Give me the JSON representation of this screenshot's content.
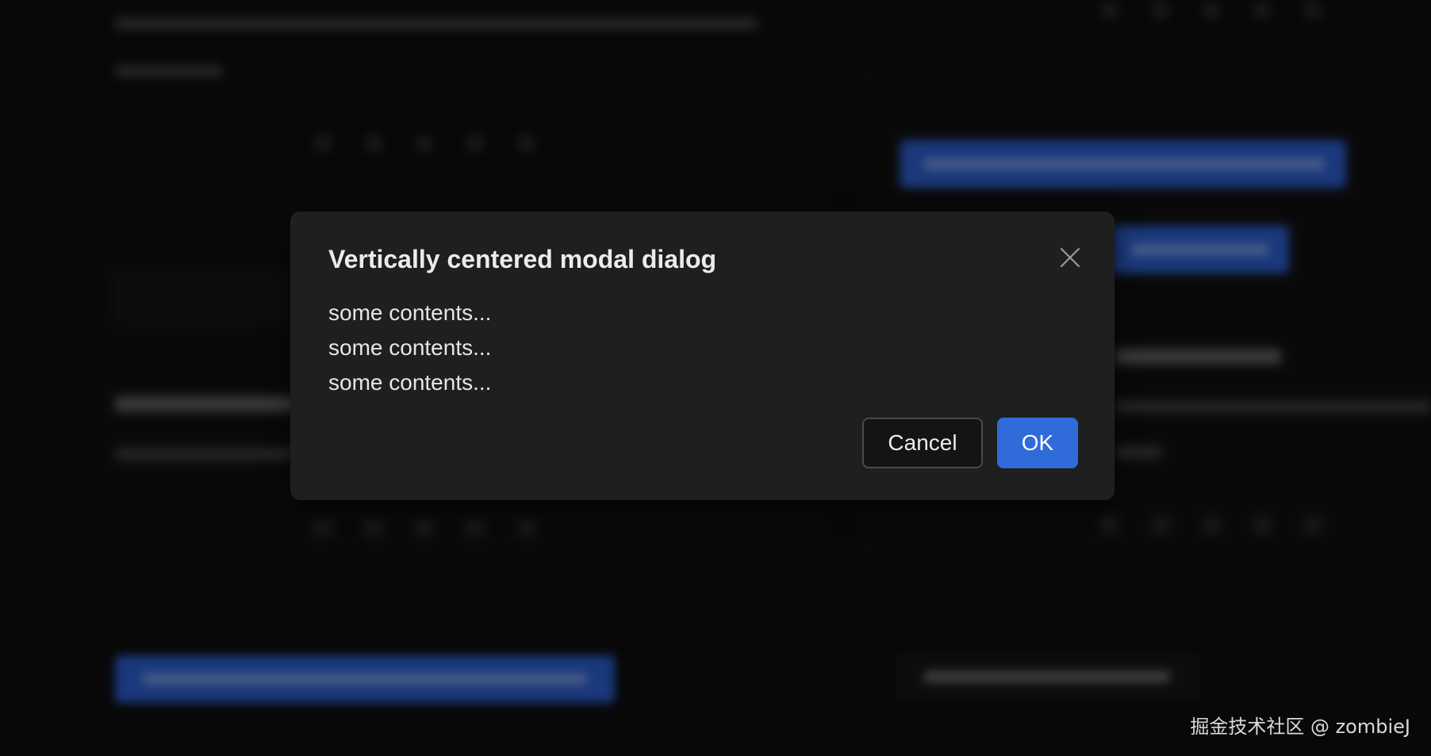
{
  "modal": {
    "title": "Vertically centered modal dialog",
    "content_lines": [
      "some contents...",
      "some contents...",
      "some contents..."
    ],
    "cancel_label": "Cancel",
    "ok_label": "OK",
    "close_icon": "close-icon"
  },
  "watermark": "掘金技术社区 @ zombieJ",
  "colors": {
    "modal_bg": "#1f1f1f",
    "primary": "#2f6bd9",
    "backdrop": "#0d0d0d"
  }
}
